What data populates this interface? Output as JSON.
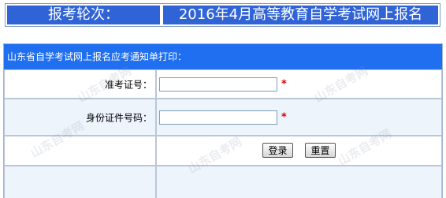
{
  "round": {
    "label": "报考轮次：",
    "value": "2016年4月高等教育自学考试网上报名"
  },
  "panel": {
    "header": "山东省自学考试网上报名应考通知单打印：",
    "fields": [
      {
        "label": "准考证号：",
        "value": "",
        "required_mark": "*"
      },
      {
        "label": "身份证件号码：",
        "value": "",
        "required_mark": "*"
      }
    ],
    "buttons": {
      "login": "登录",
      "reset": "重置"
    }
  },
  "watermark": {
    "text": "山东自考网"
  }
}
